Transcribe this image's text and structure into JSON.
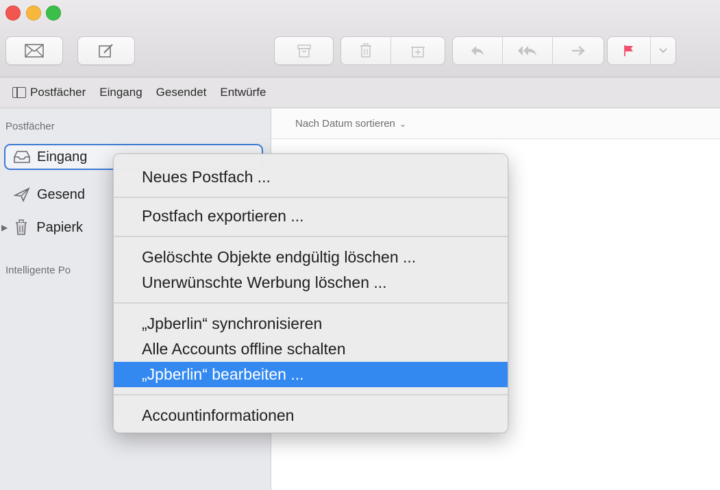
{
  "toolbar": {
    "buttons": [
      {
        "name": "get-mail",
        "icon": "envelope-icon"
      },
      {
        "name": "compose",
        "icon": "compose-icon"
      },
      {
        "name": "archive",
        "icon": "archive-icon"
      },
      {
        "name": "delete",
        "icon": "trash-icon"
      },
      {
        "name": "junk",
        "icon": "junk-icon"
      },
      {
        "name": "reply",
        "icon": "reply-icon"
      },
      {
        "name": "reply-all",
        "icon": "reply-all-icon"
      },
      {
        "name": "forward",
        "icon": "forward-icon"
      },
      {
        "name": "flag",
        "icon": "flag-icon",
        "color": "#f0506e"
      },
      {
        "name": "flag-menu",
        "icon": "chevron-down-icon"
      }
    ]
  },
  "favorites": {
    "mailboxes_label": "Postfächer",
    "items": [
      "Eingang",
      "Gesendet",
      "Entwürfe"
    ]
  },
  "sidebar": {
    "header": "Postfächer",
    "items": [
      {
        "label": "Eingang",
        "icon": "inbox-icon"
      },
      {
        "label": "Gesend",
        "icon": "sent-icon"
      },
      {
        "label": "Papierk",
        "icon": "trash-icon"
      }
    ],
    "smart_header": "Intelligente Po"
  },
  "content": {
    "sort_label": "Nach Datum sortieren"
  },
  "context_menu": {
    "groups": [
      [
        "Neues Postfach ..."
      ],
      [
        "Postfach exportieren ..."
      ],
      [
        "Gelöschte Objekte endgültig löschen ...",
        "Unerwünschte Werbung löschen ..."
      ],
      [
        "„Jpberlin“ synchronisieren",
        "Alle Accounts offline schalten",
        "„Jpberlin“ bearbeiten ..."
      ],
      [
        "Accountinformationen"
      ]
    ],
    "highlighted": "„Jpberlin“ bearbeiten ..."
  },
  "colors": {
    "accent": "#3389f0",
    "selection_border": "#3a79d6",
    "close": "#f1574e",
    "minimize": "#f7b73b",
    "zoom": "#3cbf4a"
  }
}
